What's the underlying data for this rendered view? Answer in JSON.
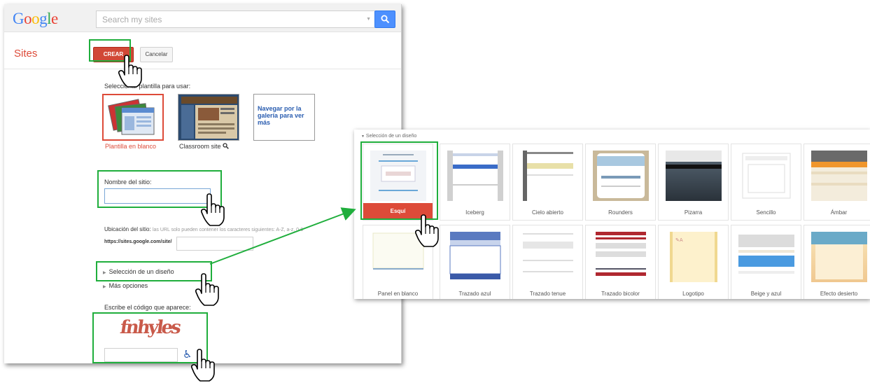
{
  "app": {
    "logo": "Google",
    "section": "Sites"
  },
  "search": {
    "placeholder": "Search my sites"
  },
  "toolbar": {
    "create_label": "CREAR",
    "cancel_label": "Cancelar"
  },
  "templates": {
    "prompt": "Seleccionar plantilla para usar:",
    "items": [
      {
        "label": "Plantilla en blanco",
        "selected": true
      },
      {
        "label": "Classroom site"
      },
      {
        "label": "Navegar por la galería para ver más"
      }
    ]
  },
  "form": {
    "site_name_label": "Nombre del sitio:",
    "site_name_value": "",
    "location_label": "Ubicación del sitio:",
    "location_hint": "las URL solo pueden contener los caracteres siguientes: A-Z, a-z, 0-9",
    "location_prefix": "https://sites.google.com/site/",
    "design_toggle": "Selección de un diseño",
    "more_options": "Más opciones",
    "captcha_label": "Escribe el código que aparece:",
    "captcha_text": "fnhyles"
  },
  "theme_panel": {
    "title": "Selección de un diseño",
    "themes": [
      {
        "name": "Esquí",
        "selected": true
      },
      {
        "name": "Iceberg"
      },
      {
        "name": "Cielo abierto"
      },
      {
        "name": "Rounders"
      },
      {
        "name": "Pizarra"
      },
      {
        "name": "Sencillo"
      },
      {
        "name": "Ámbar"
      },
      {
        "name": "Panel en blanco"
      },
      {
        "name": "Trazado azul"
      },
      {
        "name": "Trazado tenue"
      },
      {
        "name": "Trazado bicolor"
      },
      {
        "name": "Logotipo"
      },
      {
        "name": "Beige y azul"
      },
      {
        "name": "Efecto desierto"
      }
    ]
  },
  "colors": {
    "accent_red": "#dd4b39",
    "search_blue": "#4d90fe",
    "highlight_green": "#1fae3c"
  }
}
